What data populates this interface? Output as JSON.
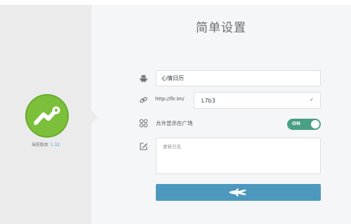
{
  "sidebar": {
    "version_label": "当前版本",
    "version_value": "1.32"
  },
  "main": {
    "title": "简单设置",
    "app_name": {
      "value": "心情日历",
      "icon": "android-icon"
    },
    "url": {
      "prefix": "http://fir.im/",
      "value": "L7b3",
      "icon": "link-icon"
    },
    "plaza": {
      "label": "允许显示在广场",
      "toggle_text": "ON",
      "enabled": true,
      "icon": "grid-icon"
    },
    "changelog": {
      "placeholder": "更新日志",
      "icon": "edit-icon"
    },
    "submit": {
      "icon": "paper-plane-icon"
    }
  },
  "colors": {
    "logo_green": "#7bbf3b",
    "toggle_green": "#4a9f86",
    "submit_blue": "#4d98bd",
    "version_blue": "#4a9bd0"
  }
}
